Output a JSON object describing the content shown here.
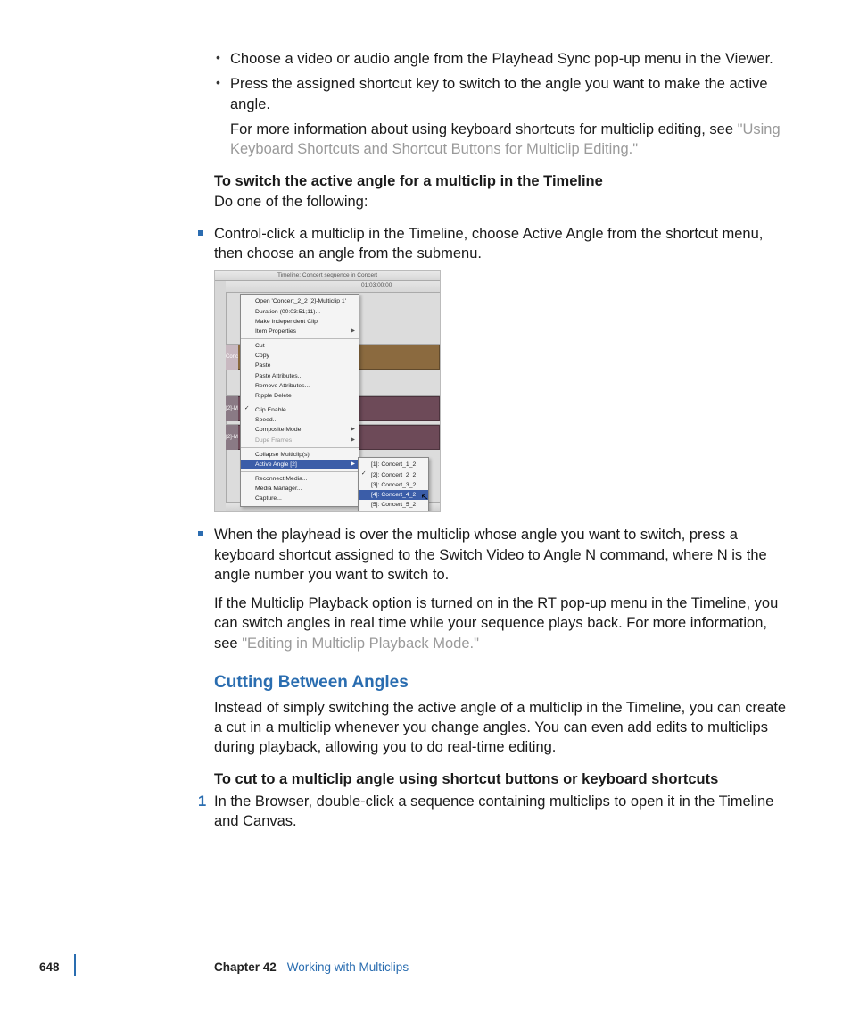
{
  "bullets": {
    "b1": "Choose a video or audio angle from the Playhead Sync pop-up menu in the Viewer.",
    "b2": "Press the assigned shortcut key to switch to the angle you want to make the active angle.",
    "b2_extra_pre": "For more information about using keyboard shortcuts for multiclip editing, see ",
    "b2_extra_link": "\"Using Keyboard Shortcuts and Shortcut Buttons for Multiclip Editing.\""
  },
  "switch_heading": "To switch the active angle for a multiclip in the Timeline",
  "switch_sub": "Do one of the following:",
  "sq1": "Control-click a multiclip in the Timeline, choose Active Angle from the shortcut menu, then choose an angle from the submenu.",
  "sq2": "When the playhead is over the multiclip whose angle you want to switch, press a keyboard shortcut assigned to the Switch Video to Angle N command, where N is the angle number you want to switch to.",
  "sq2_p_pre": "If the Multiclip Playback option is turned on in the RT pop-up menu in the Timeline, you can switch angles in real time while your sequence plays back. For more information, see ",
  "sq2_p_link": "\"Editing in Multiclip Playback Mode.\"",
  "section_title": "Cutting Between Angles",
  "section_body": "Instead of simply switching the active angle of a multiclip in the Timeline, you can create a cut in a multiclip whenever you change angles. You can even add edits to multiclips during playback, allowing you to do real-time editing.",
  "cut_heading": "To cut to a multiclip angle using shortcut buttons or keyboard shortcuts",
  "step1_num": "1",
  "step1": "In the Browser, double-click a sequence containing multiclips to open it in the Timeline and Canvas.",
  "footer": {
    "page": "648",
    "chapter": "Chapter 42",
    "title": "Working with Multiclips"
  },
  "figure": {
    "title": "Timeline: Concert sequence in Concert",
    "timecode": "01:03:00:00",
    "track_labels": {
      "v": "Conc",
      "a1": "[2]-M",
      "a2": "[2]-M"
    },
    "menu": {
      "g1": {
        "open": "Open 'Concert_2_2 [2]-Multiclip 1'",
        "duration": "Duration (00:03:51;11)...",
        "make_independent": "Make Independent Clip",
        "item_properties": "Item Properties"
      },
      "g2": {
        "cut": "Cut",
        "copy": "Copy",
        "paste": "Paste",
        "paste_attr": "Paste Attributes...",
        "remove_attr": "Remove Attributes...",
        "ripple_delete": "Ripple Delete"
      },
      "g3": {
        "clip_enable": "Clip Enable",
        "speed": "Speed...",
        "composite_mode": "Composite Mode",
        "dupe_frames": "Dupe Frames"
      },
      "g4": {
        "collapse": "Collapse Multiclip(s)",
        "active_angle": "Active Angle [2]"
      },
      "g5": {
        "reconnect": "Reconnect Media...",
        "media_manager": "Media Manager...",
        "capture": "Capture..."
      }
    },
    "submenu": {
      "a1": "[1]: Concert_1_2",
      "a2": "[2]: Concert_2_2",
      "a3": "[3]: Concert_3_2",
      "a4": "[4]: Concert_4_2",
      "a5": "[5]: Concert_5_2"
    }
  }
}
